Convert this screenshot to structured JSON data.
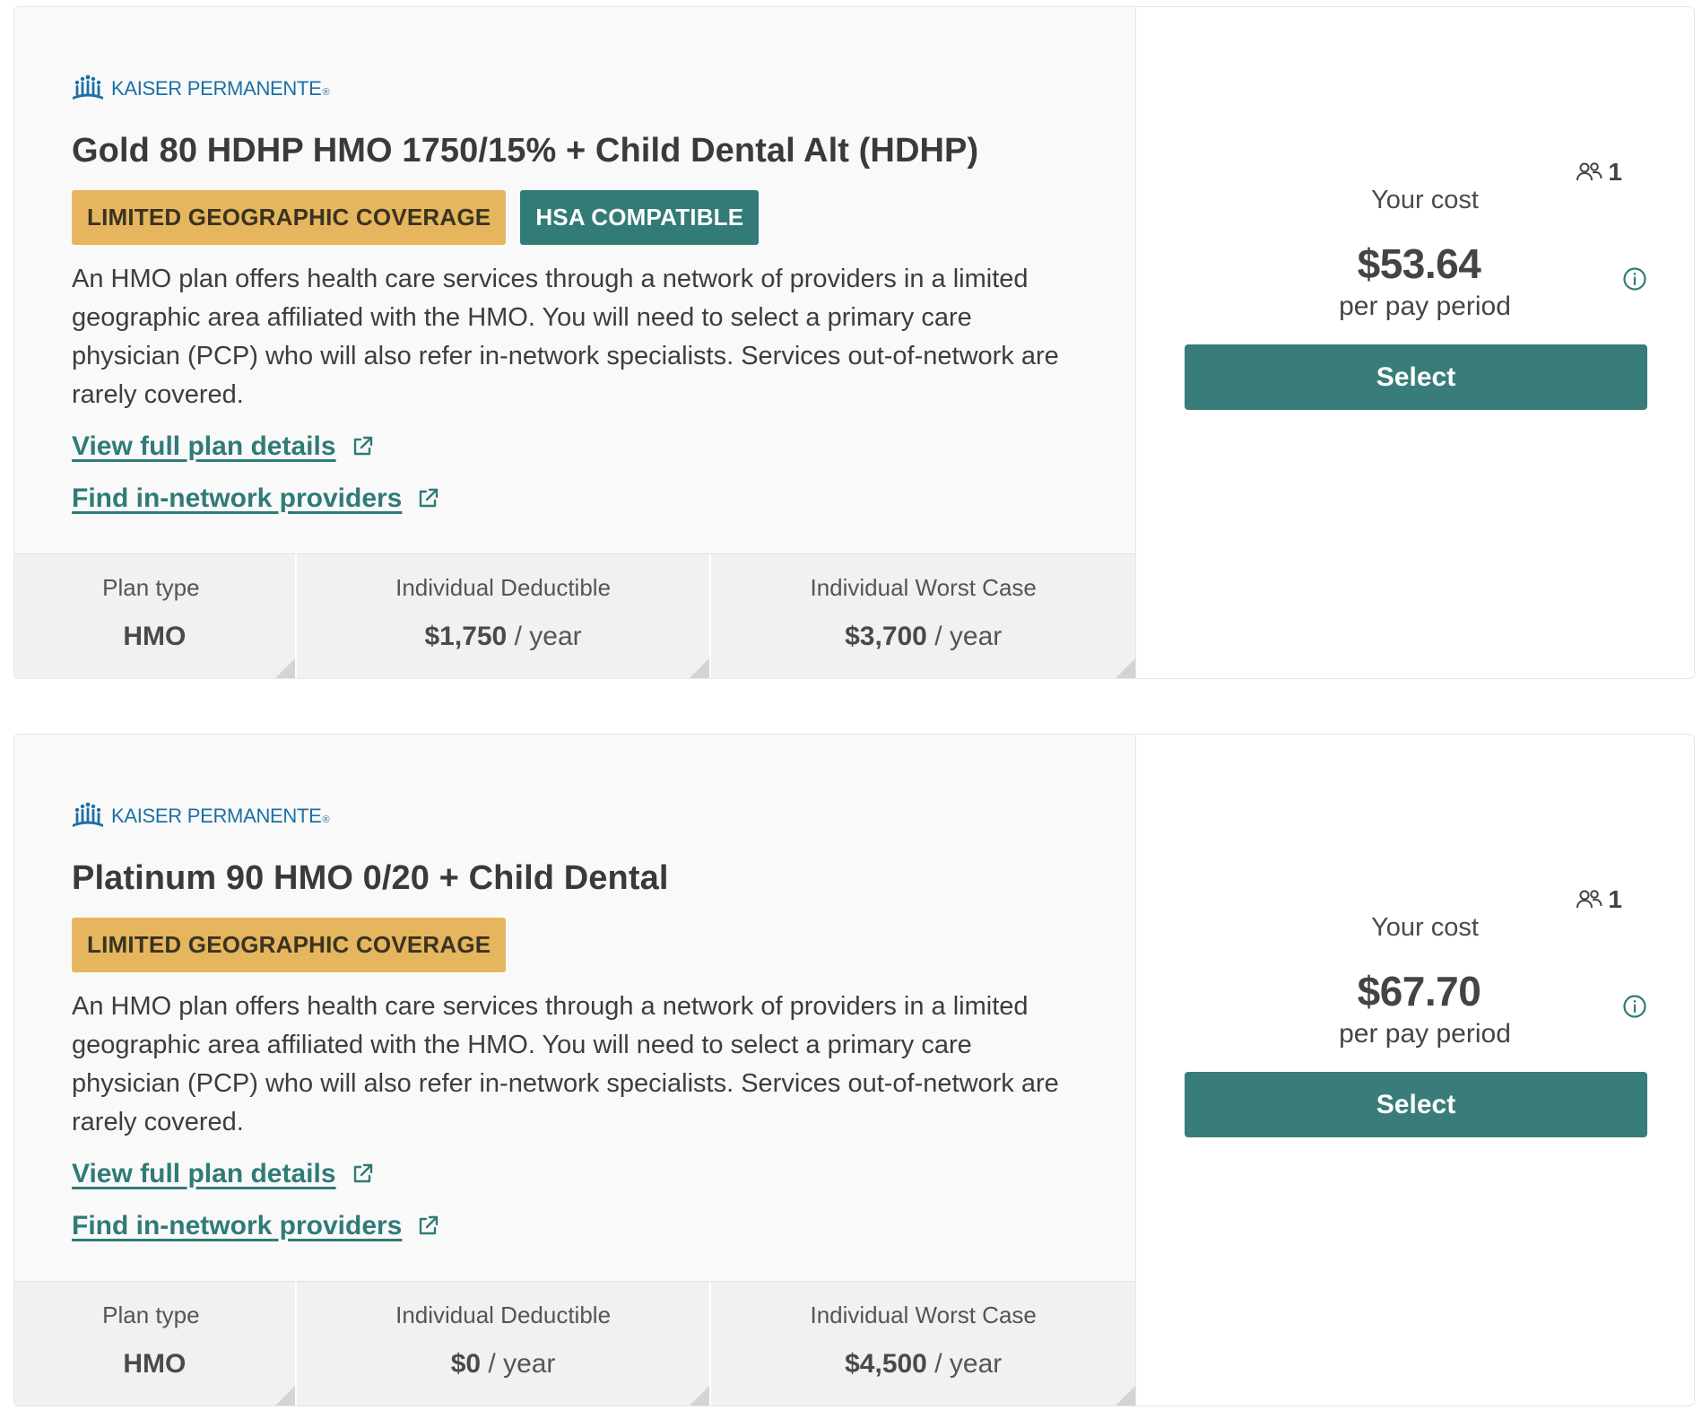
{
  "colors": {
    "accent": "#387d79",
    "link": "#2f7b77",
    "badge_geo": "#e5b65e",
    "badge_hsa": "#327b77",
    "logo": "#1d6fa5"
  },
  "plans": [
    {
      "carrier": {
        "name": "KAISER PERMANENTE",
        "reg": "®",
        "icon": "kaiser-logo-icon"
      },
      "name": "Gold 80 HDHP HMO 1750/15% + Child Dental Alt (HDHP)",
      "badges": [
        {
          "label": "LIMITED GEOGRAPHIC COVERAGE",
          "kind": "geo"
        },
        {
          "label": "HSA COMPATIBLE",
          "kind": "hsa"
        }
      ],
      "description": "An HMO plan offers health care services through a network of providers in a limited geographic area affiliated with the HMO. You will need to select a primary care physician (PCP) who will also refer in-network specialists. Services out-of-network are rarely covered.",
      "links": {
        "details": "View full plan details",
        "providers": "Find in-network providers"
      },
      "stats": [
        {
          "label": "Plan type",
          "value": "HMO",
          "unit": ""
        },
        {
          "label": "Individual Deductible",
          "value": "$1,750",
          "unit": " / year"
        },
        {
          "label": "Individual Worst Case",
          "value": "$3,700",
          "unit": " / year"
        }
      ],
      "covered_count": "1",
      "cost_label": "Your cost",
      "cost": "$53.64",
      "period": "per pay period",
      "select_label": "Select"
    },
    {
      "carrier": {
        "name": "KAISER PERMANENTE",
        "reg": "®",
        "icon": "kaiser-logo-icon"
      },
      "name": "Platinum 90 HMO 0/20 + Child Dental",
      "badges": [
        {
          "label": "LIMITED GEOGRAPHIC COVERAGE",
          "kind": "geo"
        }
      ],
      "description": "An HMO plan offers health care services through a network of providers in a limited geographic area affiliated with the HMO. You will need to select a primary care physician (PCP) who will also refer in-network specialists. Services out-of-network are rarely covered.",
      "links": {
        "details": "View full plan details",
        "providers": "Find in-network providers"
      },
      "stats": [
        {
          "label": "Plan type",
          "value": "HMO",
          "unit": ""
        },
        {
          "label": "Individual Deductible",
          "value": "$0",
          "unit": " / year"
        },
        {
          "label": "Individual Worst Case",
          "value": "$4,500",
          "unit": " / year"
        }
      ],
      "covered_count": "1",
      "cost_label": "Your cost",
      "cost": "$67.70",
      "period": "per pay period",
      "select_label": "Select"
    }
  ]
}
